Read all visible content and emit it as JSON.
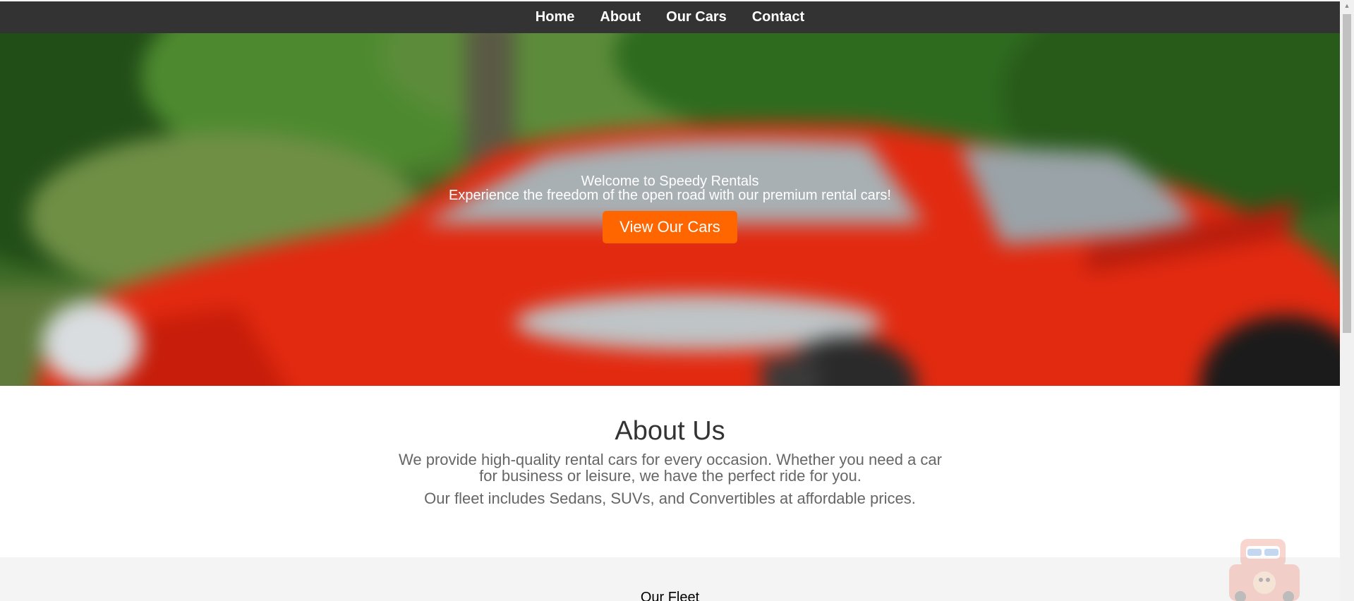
{
  "nav": {
    "items": [
      {
        "label": "Home"
      },
      {
        "label": "About"
      },
      {
        "label": "Our Cars"
      },
      {
        "label": "Contact"
      }
    ]
  },
  "hero": {
    "title": "Welcome to Speedy Rentals",
    "subtitle": "Experience the freedom of the open road with our premium rental cars!",
    "cta_label": "View Our Cars",
    "cta_color": "#ff6600"
  },
  "about": {
    "heading": "About Us",
    "paragraph_1": "We provide high-quality rental cars for every occasion. Whether you need a car for business or leisure, we have the perfect ride for you.",
    "paragraph_2": "Our fleet includes Sedans, SUVs, and Convertibles at affordable prices."
  },
  "fleet": {
    "heading": "Our Fleet"
  },
  "colors": {
    "navbar": "#333333",
    "accent": "#ff6600",
    "section_bg": "#f4f4f4"
  },
  "icons": {
    "scroll_up": "triangle-up-icon",
    "mascot": "robot-mascot-icon"
  }
}
